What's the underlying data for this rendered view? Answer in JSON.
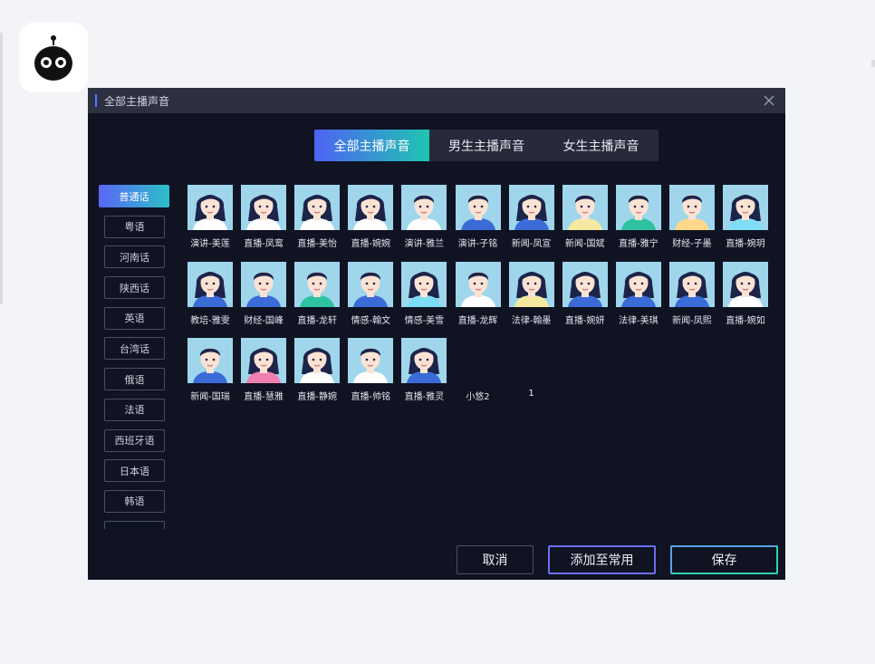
{
  "dialog": {
    "title": "全部主播声音",
    "tabs": [
      "全部主播声音",
      "男生主播声音",
      "女生主播声音"
    ],
    "languages": [
      "普通话",
      "粤语",
      "河南话",
      "陕西话",
      "英语",
      "台湾话",
      "俄语",
      "法语",
      "西班牙语",
      "日本语",
      "韩语"
    ],
    "voices": [
      {
        "name": "演讲-美莲",
        "gender": "female",
        "shirt": "#ffffff"
      },
      {
        "name": "直播-凤鸾",
        "gender": "female",
        "shirt": "#ffffff"
      },
      {
        "name": "直播-美怡",
        "gender": "female",
        "shirt": "#ffffff"
      },
      {
        "name": "直播-婉婉",
        "gender": "female",
        "shirt": "#ffffff"
      },
      {
        "name": "演讲-雅兰",
        "gender": "male",
        "shirt": "#ffffff"
      },
      {
        "name": "演讲-子铭",
        "gender": "male",
        "shirt": "#3b6bd6"
      },
      {
        "name": "新闻-凤宣",
        "gender": "female",
        "shirt": "#3b6bd6"
      },
      {
        "name": "新闻-国斌",
        "gender": "male",
        "shirt": "#f3e9a0"
      },
      {
        "name": "直播-雅宁",
        "gender": "male",
        "shirt": "#2ec3a0"
      },
      {
        "name": "财经-子墨",
        "gender": "male",
        "shirt": "#ffd88a"
      },
      {
        "name": "直播-婉玥",
        "gender": "female",
        "shirt": "#7fdcf5"
      },
      {
        "name": "教培-雅雯",
        "gender": "female",
        "shirt": "#3b6bd6"
      },
      {
        "name": "财经-国峰",
        "gender": "male",
        "shirt": "#3b6bd6"
      },
      {
        "name": "直播-龙轩",
        "gender": "male",
        "shirt": "#2ec3a0"
      },
      {
        "name": "情感-翰文",
        "gender": "male",
        "shirt": "#3b6bd6"
      },
      {
        "name": "情感-美雪",
        "gender": "female",
        "shirt": "#7fdcf5"
      },
      {
        "name": "直播-龙辉",
        "gender": "male",
        "shirt": "#ffffff"
      },
      {
        "name": "法律-翰墨",
        "gender": "female",
        "shirt": "#f3e9a0"
      },
      {
        "name": "直播-婉妍",
        "gender": "female",
        "shirt": "#3b6bd6"
      },
      {
        "name": "法律-美琪",
        "gender": "female",
        "shirt": "#3b6bd6"
      },
      {
        "name": "新闻-凤熙",
        "gender": "female",
        "shirt": "#3b6bd6"
      },
      {
        "name": "直播-婉如",
        "gender": "female",
        "shirt": "#ffffff"
      },
      {
        "name": "新闻-国瑞",
        "gender": "male",
        "shirt": "#3b6bd6"
      },
      {
        "name": "直播-慧雅",
        "gender": "female",
        "shirt": "#ef7fb0"
      },
      {
        "name": "直播-静婉",
        "gender": "female",
        "shirt": "#ffffff"
      },
      {
        "name": "直播-帅铭",
        "gender": "male",
        "shirt": "#ffffff"
      },
      {
        "name": "直播-雅灵",
        "gender": "female",
        "shirt": "#3b6bd6"
      },
      {
        "name": "小悠2",
        "gender": "none",
        "shirt": ""
      },
      {
        "name": "1",
        "gender": "none",
        "shirt": ""
      }
    ],
    "buttons": {
      "cancel": "取消",
      "add_common": "添加至常用",
      "save": "保存"
    }
  },
  "colors": {
    "dialog_bg": "#0f1322",
    "titlebar_bg": "#2c3040",
    "accent_gradient_start": "#4f63f4",
    "accent_gradient_end": "#1fc5b1",
    "avatar_bg": "#9fd6ec",
    "hair": "#1d2449"
  },
  "icons": [
    "app-logo-robot-icon",
    "close-icon"
  ]
}
